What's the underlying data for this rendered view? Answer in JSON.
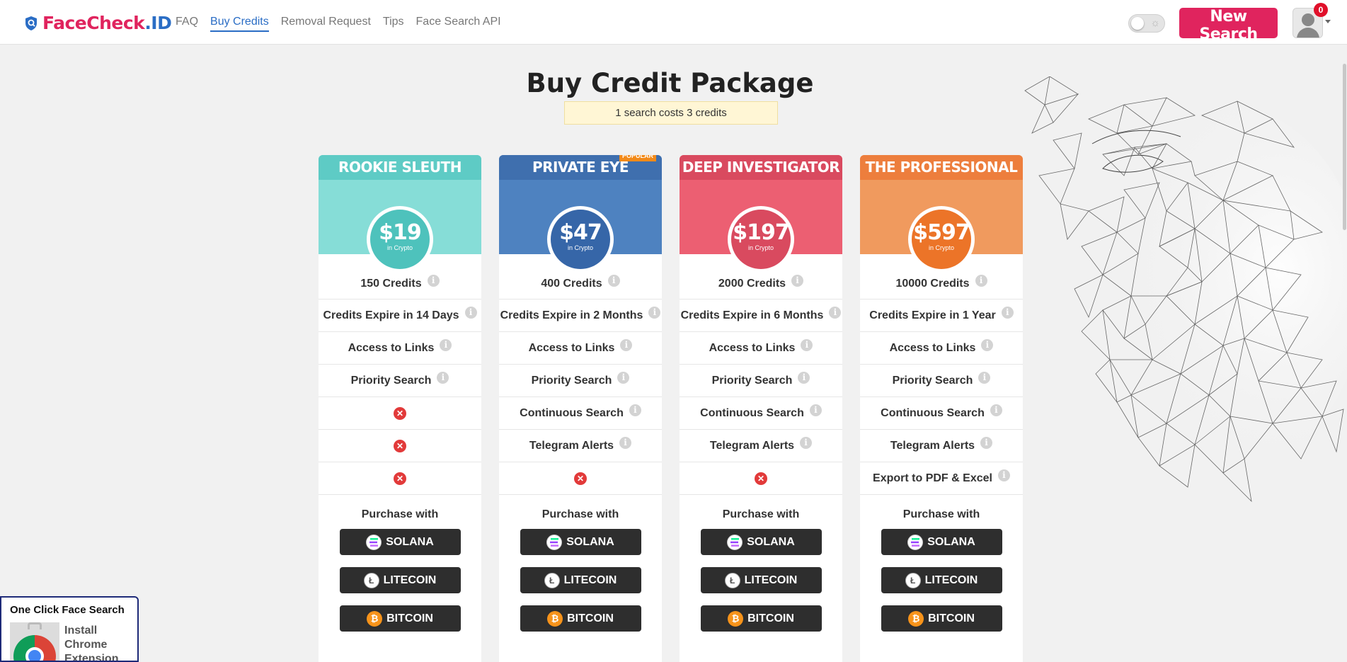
{
  "header": {
    "logo_part1": "FaceCheck",
    "logo_part2": ".ID",
    "nav": [
      {
        "label": "FAQ",
        "active": false
      },
      {
        "label": "Buy Credits",
        "active": true
      },
      {
        "label": "Removal Request",
        "active": false
      },
      {
        "label": "Tips",
        "active": false
      },
      {
        "label": "Face Search API",
        "active": false
      }
    ],
    "theme_toggle_icon": "sun-icon",
    "new_search_label": "New Search",
    "notification_count": "0"
  },
  "page": {
    "title": "Buy Credit Package",
    "cost_note": "1 search costs 3 credits"
  },
  "plans": [
    {
      "name": "ROOKIE SLEUTH",
      "price": "$19",
      "price_sub": "in Crypto",
      "popular": "",
      "head_color": "#86ddd7",
      "title_color": "#5ecbc5",
      "circle_color": "#4ec2bc",
      "features": [
        "150 Credits",
        "Credits Expire in 14 Days",
        "Access to Links",
        "Priority Search",
        "",
        "",
        ""
      ],
      "purchase_label": "Purchase with",
      "payments": [
        "SOLANA",
        "LITECOIN",
        "BITCOIN"
      ]
    },
    {
      "name": "PRIVATE EYE",
      "price": "$47",
      "price_sub": "in Crypto",
      "popular": "POPULAR",
      "head_color": "#4e82c0",
      "title_color": "#3f6fae",
      "circle_color": "#3666a8",
      "features": [
        "400 Credits",
        "Credits Expire in 2 Months",
        "Access to Links",
        "Priority Search",
        "Continuous Search",
        "Telegram Alerts",
        ""
      ],
      "purchase_label": "Purchase with",
      "payments": [
        "SOLANA",
        "LITECOIN",
        "BITCOIN"
      ]
    },
    {
      "name": "DEEP INVESTIGATOR",
      "price": "$197",
      "price_sub": "in Crypto",
      "popular": "",
      "head_color": "#ec5f72",
      "title_color": "#d94a5f",
      "circle_color": "#d94a5f",
      "features": [
        "2000 Credits",
        "Credits Expire in 6 Months",
        "Access to Links",
        "Priority Search",
        "Continuous Search",
        "Telegram Alerts",
        ""
      ],
      "purchase_label": "Purchase with",
      "payments": [
        "SOLANA",
        "LITECOIN",
        "BITCOIN"
      ]
    },
    {
      "name": "THE PROFESSIONAL",
      "price": "$597",
      "price_sub": "in Crypto",
      "popular": "",
      "head_color": "#f09a5e",
      "title_color": "#ed7e3d",
      "circle_color": "#ec7428",
      "features": [
        "10000 Credits",
        "Credits Expire in 1 Year",
        "Access to Links",
        "Priority Search",
        "Continuous Search",
        "Telegram Alerts",
        "Export to PDF & Excel"
      ],
      "purchase_label": "Purchase with",
      "payments": [
        "SOLANA",
        "LITECOIN",
        "BITCOIN"
      ]
    }
  ],
  "extension": {
    "title": "One Click Face Search",
    "text": "Install Chrome Extension"
  }
}
